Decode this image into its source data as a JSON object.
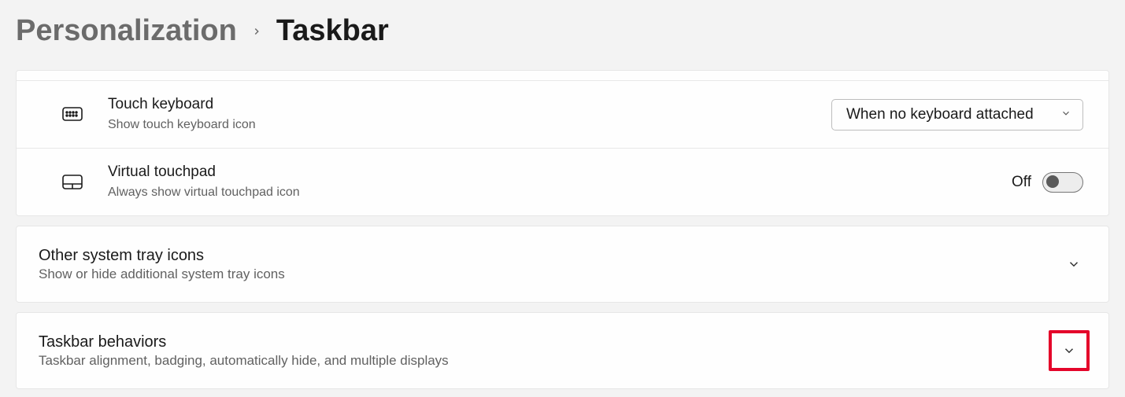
{
  "breadcrumb": {
    "parent": "Personalization",
    "current": "Taskbar"
  },
  "rows": {
    "touchKeyboard": {
      "title": "Touch keyboard",
      "sub": "Show touch keyboard icon",
      "dropdownValue": "When no keyboard attached"
    },
    "virtualTouchpad": {
      "title": "Virtual touchpad",
      "sub": "Always show virtual touchpad icon",
      "toggleLabel": "Off"
    }
  },
  "sections": {
    "otherTray": {
      "title": "Other system tray icons",
      "sub": "Show or hide additional system tray icons"
    },
    "behaviors": {
      "title": "Taskbar behaviors",
      "sub": "Taskbar alignment, badging, automatically hide, and multiple displays"
    }
  }
}
